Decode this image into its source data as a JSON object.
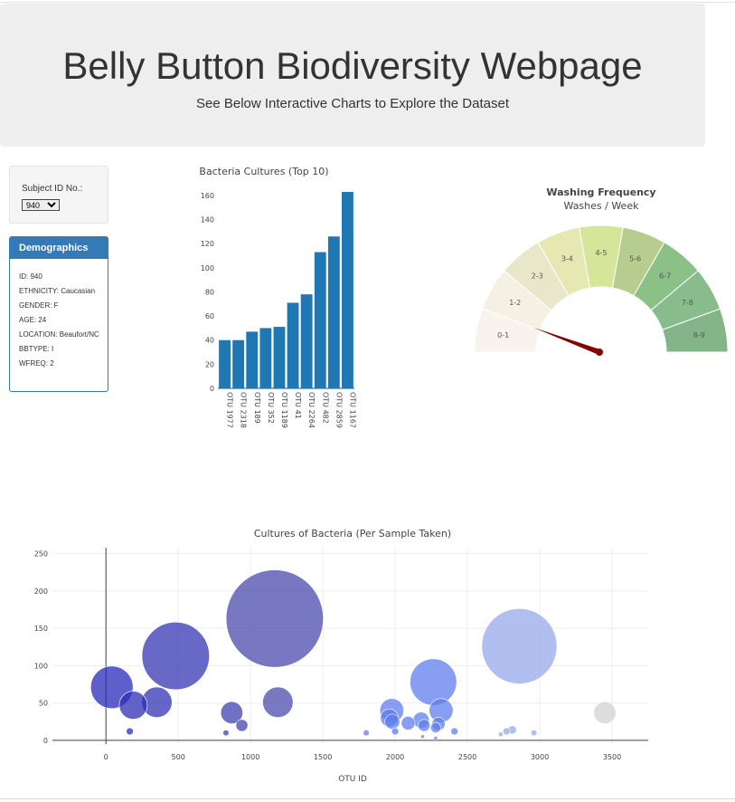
{
  "header": {
    "title": "Belly Button Biodiversity Webpage",
    "subtitle": "See Below Interactive Charts to Explore the Dataset"
  },
  "selector": {
    "label": "Subject ID No.:",
    "selected": "940"
  },
  "demographics": {
    "title": "Demographics",
    "lines": [
      "ID: 940",
      "ETHNICITY: Caucasian",
      "GENDER: F",
      "AGE: 24",
      "LOCATION: Beaufort/NC",
      "BBTYPE: I",
      "WFREQ: 2"
    ]
  },
  "colors": {
    "bar": "#1f77b4",
    "panel": "#337ab7",
    "needle": "#850000"
  },
  "chart_data": [
    {
      "type": "bar",
      "title": "Bacteria Cultures (Top 10)",
      "categories": [
        "OTU 1977",
        "OTU 2318",
        "OTU 189",
        "OTU 352",
        "OTU 1189",
        "OTU 41",
        "OTU 2264",
        "OTU 482",
        "OTU 2859",
        "OTU 1167"
      ],
      "values": [
        40,
        40,
        47,
        50,
        51,
        71,
        78,
        113,
        126,
        163
      ],
      "yticks": [
        0,
        20,
        40,
        60,
        80,
        100,
        120,
        140,
        160
      ],
      "ylim": [
        0,
        172
      ]
    },
    {
      "type": "gauge",
      "title": "Washing Frequency",
      "subtitle": "Washes / Week",
      "sections": [
        "0-1",
        "1-2",
        "2-3",
        "3-4",
        "4-5",
        "5-6",
        "6-7",
        "7-8",
        "8-9"
      ],
      "section_colors": [
        "#f8f3ec",
        "#f4f1e4",
        "#e9e7c9",
        "#e5e8b0",
        "#d5e599",
        "#b7cd8f",
        "#8bc086",
        "#89bc8d",
        "#84b589"
      ],
      "value": 2,
      "range": [
        0,
        9
      ]
    },
    {
      "type": "scatter",
      "title": "Cultures of Bacteria (Per Sample Taken)",
      "xlabel": "OTU ID",
      "xticks": [
        0,
        500,
        1000,
        1500,
        2000,
        2500,
        3000,
        3500
      ],
      "yticks": [
        0,
        50,
        100,
        150,
        200,
        250
      ],
      "xlim": [
        -370,
        3750
      ],
      "ylim": [
        -5,
        258
      ],
      "x": [
        41,
        189,
        352,
        482,
        1167,
        1189,
        870,
        940,
        165,
        830,
        1977,
        1960,
        1980,
        2090,
        2180,
        2264,
        2318,
        2300,
        2859,
        3450,
        2200,
        2280,
        2000,
        1800,
        2410,
        2730,
        2770,
        2810,
        2960,
        2190,
        2280
      ],
      "y": [
        71,
        47,
        51,
        113,
        163,
        51,
        37,
        20,
        12,
        10,
        40,
        30,
        25,
        23,
        27,
        78,
        40,
        22,
        126,
        37,
        20,
        17,
        12,
        10,
        12,
        8,
        12,
        14,
        10,
        5,
        3
      ]
    }
  ]
}
